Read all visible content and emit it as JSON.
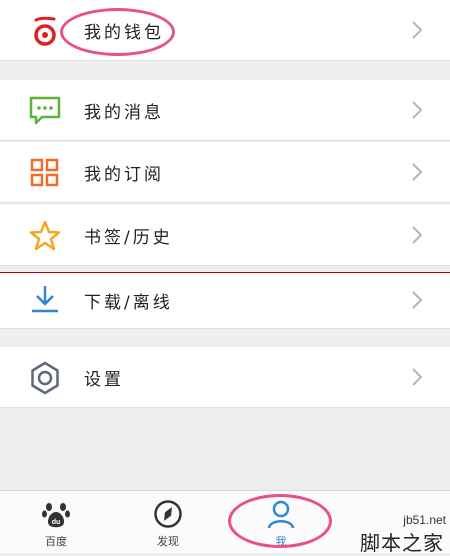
{
  "menu": [
    {
      "label": "我的钱包",
      "icon": "wallet-icon"
    },
    {
      "label": "我的消息",
      "icon": "message-icon"
    },
    {
      "label": "我的订阅",
      "icon": "subscription-grid-icon"
    },
    {
      "label": "书签/历史",
      "icon": "star-icon"
    },
    {
      "label": "下载/离线",
      "icon": "download-icon"
    },
    {
      "label": "设置",
      "icon": "settings-gear-icon"
    }
  ],
  "tabs": [
    {
      "label": "百度",
      "icon": "baidu-paw-icon"
    },
    {
      "label": "发现",
      "icon": "compass-icon"
    },
    {
      "label": "我",
      "icon": "person-icon"
    }
  ],
  "watermark": {
    "site": "jb51.net",
    "name": "脚本之家"
  },
  "colors": {
    "accent": "#e94f88",
    "wallet": "#e02020",
    "message": "#5fb236",
    "grid": "#ef6d2b",
    "star": "#f5a623",
    "download": "#2f86d4",
    "gear": "#5a6a7a",
    "tab_active": "#2f86d4"
  }
}
